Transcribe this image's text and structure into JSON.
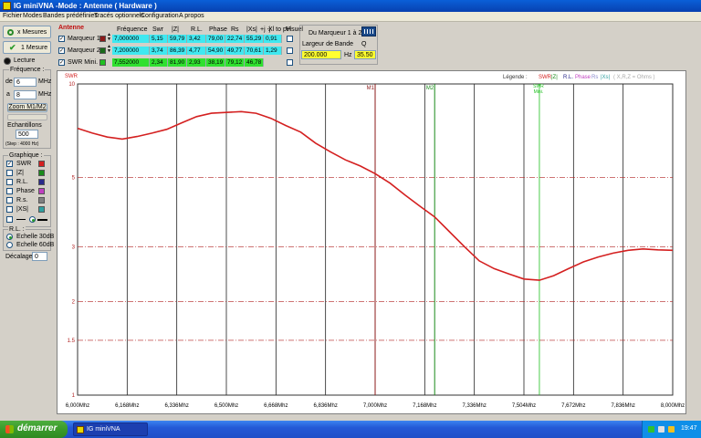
{
  "window": {
    "title": "IG miniVNA -Mode : Antenne ( Hardware )"
  },
  "menu": [
    "Fichier",
    "Modes",
    "Bandes prédéfinies",
    "Tracés optionnels",
    "Configuration",
    "A propos"
  ],
  "left": {
    "btn_x_mesures": "x Mesures",
    "btn_1_mesure": "1 Mesure",
    "lecture": "Lecture",
    "frequence_label": "Fréquence :",
    "de_label": "de",
    "de_value": "6",
    "a_label": "a",
    "a_value": "8",
    "mhz": "MHz",
    "zoom_btn": "Zoom M1/M2",
    "echantillons_label": "Echantillons",
    "echantillons_value": "500",
    "step_label": "(Step : 4000 Hz)",
    "graphique_label": "Graphique :",
    "graph_items": [
      {
        "label": "SWR",
        "checked": true,
        "color": "#d42020"
      },
      {
        "label": "|Z|",
        "checked": false,
        "color": "#1a8a1a"
      },
      {
        "label": "R.L.",
        "checked": false,
        "color": "#2a2a8a"
      },
      {
        "label": "Phase",
        "checked": false,
        "color": "#c040c0"
      },
      {
        "label": "R.s.",
        "checked": false,
        "color": "#808080"
      },
      {
        "label": "|XS|",
        "checked": false,
        "color": "#30a0a0"
      }
    ],
    "rl_label": "R.L. :",
    "echelle_30": "Echelle 30dB",
    "echelle_60": "Echelle 60dB",
    "decalage_label": "Décalage",
    "decalage_value": "0"
  },
  "markers": {
    "antenne_label": "Antenne",
    "headers": [
      "Fréquence",
      "Swr",
      "|Z|",
      "R.L.",
      "Phase",
      "Rs",
      "|Xs|",
      "+j -j",
      "Xl to pH",
      "Visuel"
    ],
    "rows": [
      {
        "name": "Marqueur 1",
        "color": "#8b1a1a",
        "bg": "#40e8f0",
        "values": [
          "7,000000",
          "5,15",
          "59,79",
          "3,42",
          "79,00",
          "22,74",
          "55,29",
          "0,91"
        ]
      },
      {
        "name": "Marqueur 2",
        "color": "#1a6a1a",
        "bg": "#40e8f0",
        "values": [
          "7,200000",
          "3,74",
          "86,39",
          "4,77",
          "54,90",
          "49,77",
          "70,61",
          "1,29"
        ]
      },
      {
        "name": "SWR Mini.",
        "color": "#20c020",
        "bg": "#30e030",
        "values": [
          "7,552000",
          "2,34",
          "81,90",
          "2,93",
          "38,19",
          "79,12",
          "46,78",
          ""
        ]
      }
    ],
    "du_marqueur": "Du Marqueur 1 à 2",
    "largeur_label": "Largeur de Bande",
    "q_label": "Q",
    "largeur_value": "200.000",
    "hz": "Hz",
    "q_value": "35.50"
  },
  "chart_data": {
    "type": "line",
    "ylabel": "SWR",
    "legend_title": "Légende :",
    "legend_items": [
      {
        "label": "SWR",
        "color": "#d42020"
      },
      {
        "label": "|Z|",
        "color": "#1a8a1a"
      },
      {
        "label": "R.L.",
        "color": "#2a2a8a"
      },
      {
        "label": "Phase",
        "color": "#c040c0"
      },
      {
        "label": "Rs",
        "color": "#8888cc"
      },
      {
        "label": "|Xs|",
        "color": "#30a0a0"
      },
      {
        "label": "( X,R,Z = Ohms )",
        "color": "#aaaaaa"
      }
    ],
    "x_ticks": [
      "6,000Mhz",
      "6,168Mhz",
      "6,336Mhz",
      "6,500Mhz",
      "6,668Mhz",
      "6,836Mhz",
      "7,000Mhz",
      "7,168Mhz",
      "7,336Mhz",
      "7,504Mhz",
      "7,672Mhz",
      "7,836Mhz",
      "8,000Mhz"
    ],
    "xlim": [
      6.0,
      8.0
    ],
    "y_ticks": [
      "10",
      "5",
      "3",
      "2",
      "1.5",
      "1"
    ],
    "y_tick_values": [
      10,
      5,
      3,
      2,
      1.5,
      1
    ],
    "y_scale": "log",
    "ylim": [
      1,
      10
    ],
    "markers": [
      {
        "label": "M1",
        "x": 7.0,
        "color": "#8b1a1a"
      },
      {
        "label": "M2",
        "x": 7.2,
        "color": "#1a8a1a"
      },
      {
        "label": "SWR Mini.",
        "x": 7.552,
        "color": "#20c020"
      }
    ],
    "series": [
      {
        "color": "#d42020",
        "x": [
          6.0,
          6.05,
          6.1,
          6.15,
          6.2,
          6.25,
          6.3,
          6.35,
          6.4,
          6.45,
          6.5,
          6.55,
          6.6,
          6.65,
          6.7,
          6.75,
          6.8,
          6.85,
          6.9,
          6.95,
          7.0,
          7.05,
          7.1,
          7.15,
          7.2,
          7.25,
          7.3,
          7.35,
          7.4,
          7.45,
          7.5,
          7.552,
          7.6,
          7.65,
          7.7,
          7.75,
          7.8,
          7.85,
          7.9,
          7.95,
          8.0
        ],
        "values": [
          7.2,
          6.95,
          6.75,
          6.65,
          6.78,
          6.95,
          7.15,
          7.5,
          7.85,
          8.05,
          8.1,
          8.15,
          8.05,
          7.75,
          7.35,
          7.0,
          6.45,
          6.05,
          5.7,
          5.45,
          5.15,
          4.8,
          4.4,
          4.05,
          3.74,
          3.35,
          3.0,
          2.7,
          2.55,
          2.45,
          2.36,
          2.34,
          2.42,
          2.55,
          2.68,
          2.78,
          2.86,
          2.92,
          2.95,
          2.93,
          2.92
        ]
      }
    ]
  },
  "taskbar": {
    "start": "démarrer",
    "task": "IG miniVNA",
    "clock": "19:47"
  }
}
